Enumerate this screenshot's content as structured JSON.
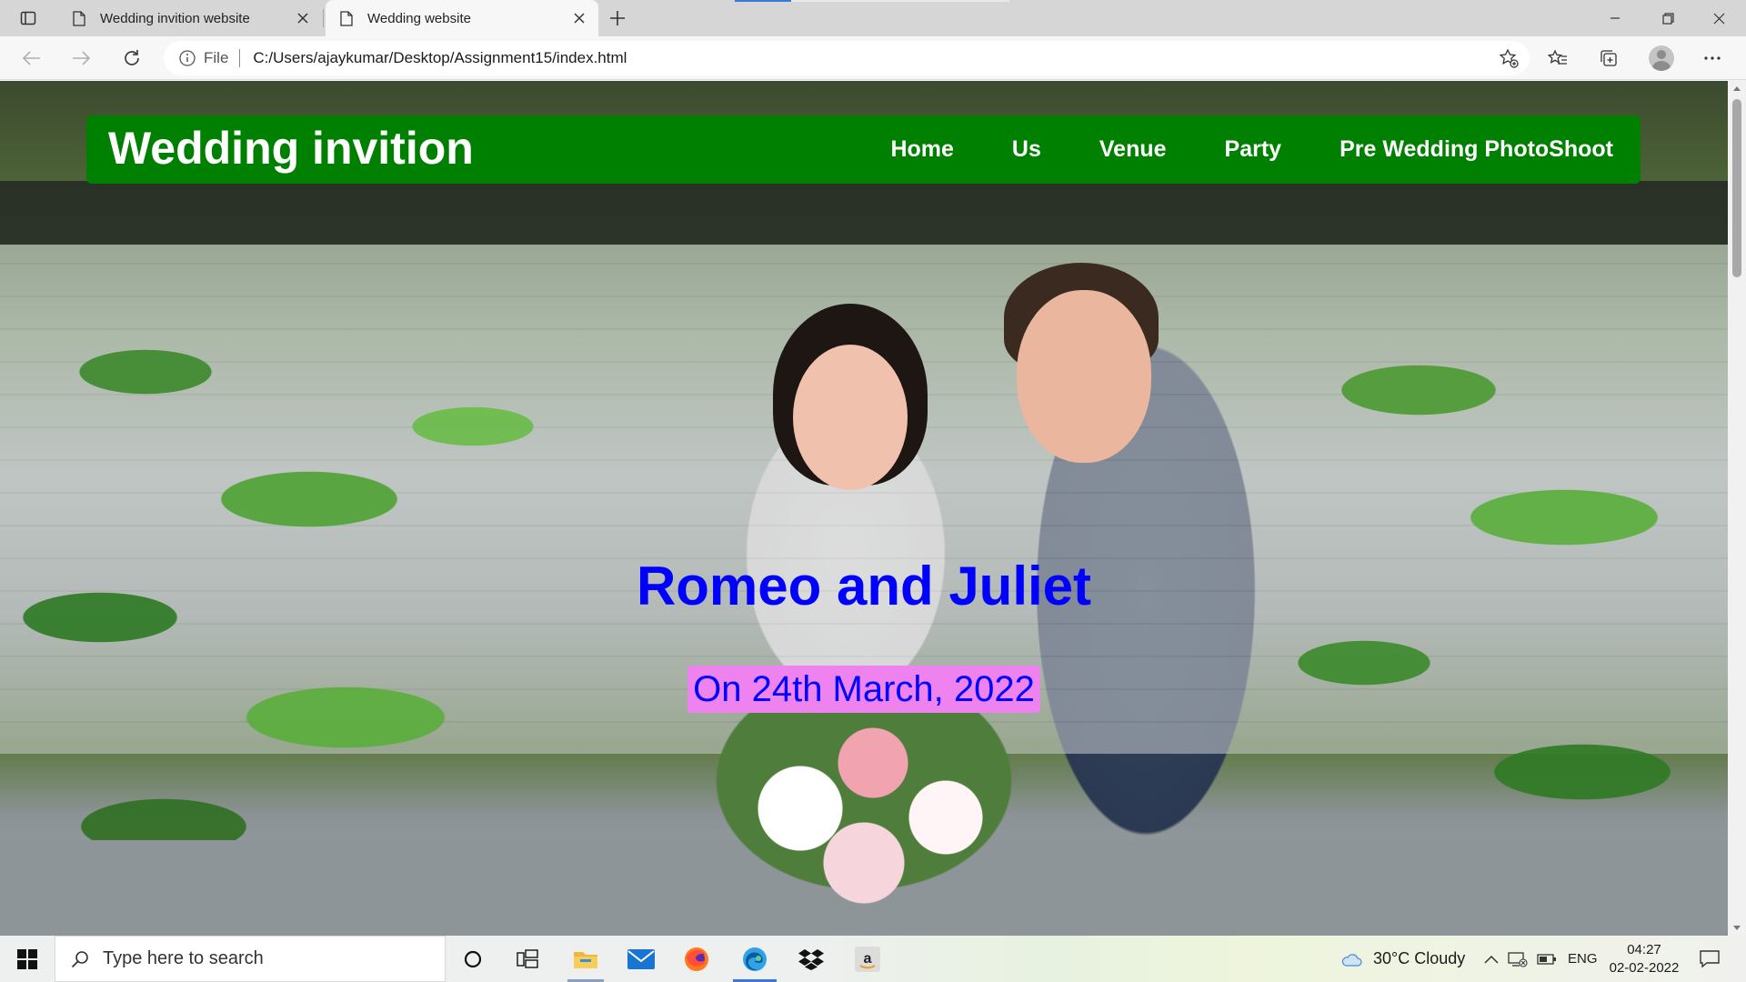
{
  "browser": {
    "tabs": [
      {
        "title": "Wedding invition website",
        "active": false
      },
      {
        "title": "Wedding website",
        "active": true
      }
    ],
    "address": {
      "scheme": "File",
      "url": "C:/Users/ajaykumar/Desktop/Assignment15/index.html"
    }
  },
  "page": {
    "header": {
      "title": "Wedding invition",
      "bg_color": "#008000"
    },
    "nav": [
      {
        "label": "Home"
      },
      {
        "label": "Us"
      },
      {
        "label": "Venue"
      },
      {
        "label": "Party"
      },
      {
        "label": "Pre Wedding PhotoShoot"
      }
    ],
    "hero": {
      "names": "Romeo and Juliet",
      "date": "On 24th March, 2022",
      "names_color": "#0000ff",
      "date_bg_color": "#ee82ee"
    }
  },
  "taskbar": {
    "search_placeholder": "Type here to search",
    "weather": "30°C  Cloudy",
    "language": "ENG",
    "time": "04:27",
    "date": "02-02-2022"
  }
}
